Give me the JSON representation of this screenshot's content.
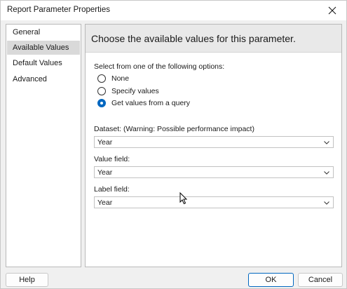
{
  "window": {
    "title": "Report Parameter Properties"
  },
  "nav": {
    "items": [
      {
        "label": "General",
        "selected": false
      },
      {
        "label": "Available Values",
        "selected": true
      },
      {
        "label": "Default Values",
        "selected": false
      },
      {
        "label": "Advanced",
        "selected": false
      }
    ]
  },
  "content": {
    "header": "Choose the available values for this parameter.",
    "options_label": "Select from one of the following options:",
    "options": [
      {
        "label": "None",
        "checked": false
      },
      {
        "label": "Specify values",
        "checked": false
      },
      {
        "label": "Get values from a query",
        "checked": true
      }
    ],
    "dataset": {
      "label": "Dataset: (Warning: Possible performance impact)",
      "value": "Year"
    },
    "value_field": {
      "label": "Value field:",
      "value": "Year"
    },
    "label_field": {
      "label": "Label field:",
      "value": "Year"
    }
  },
  "buttons": {
    "help": "Help",
    "ok": "OK",
    "cancel": "Cancel"
  },
  "colors": {
    "accent": "#0067c0",
    "nav_selected": "#d9d9d9",
    "header_bg": "#e9e9e9"
  },
  "icons": {
    "close": "close-icon",
    "dropdown": "chevron-down-icon",
    "pointer": "mouse-pointer-icon"
  }
}
